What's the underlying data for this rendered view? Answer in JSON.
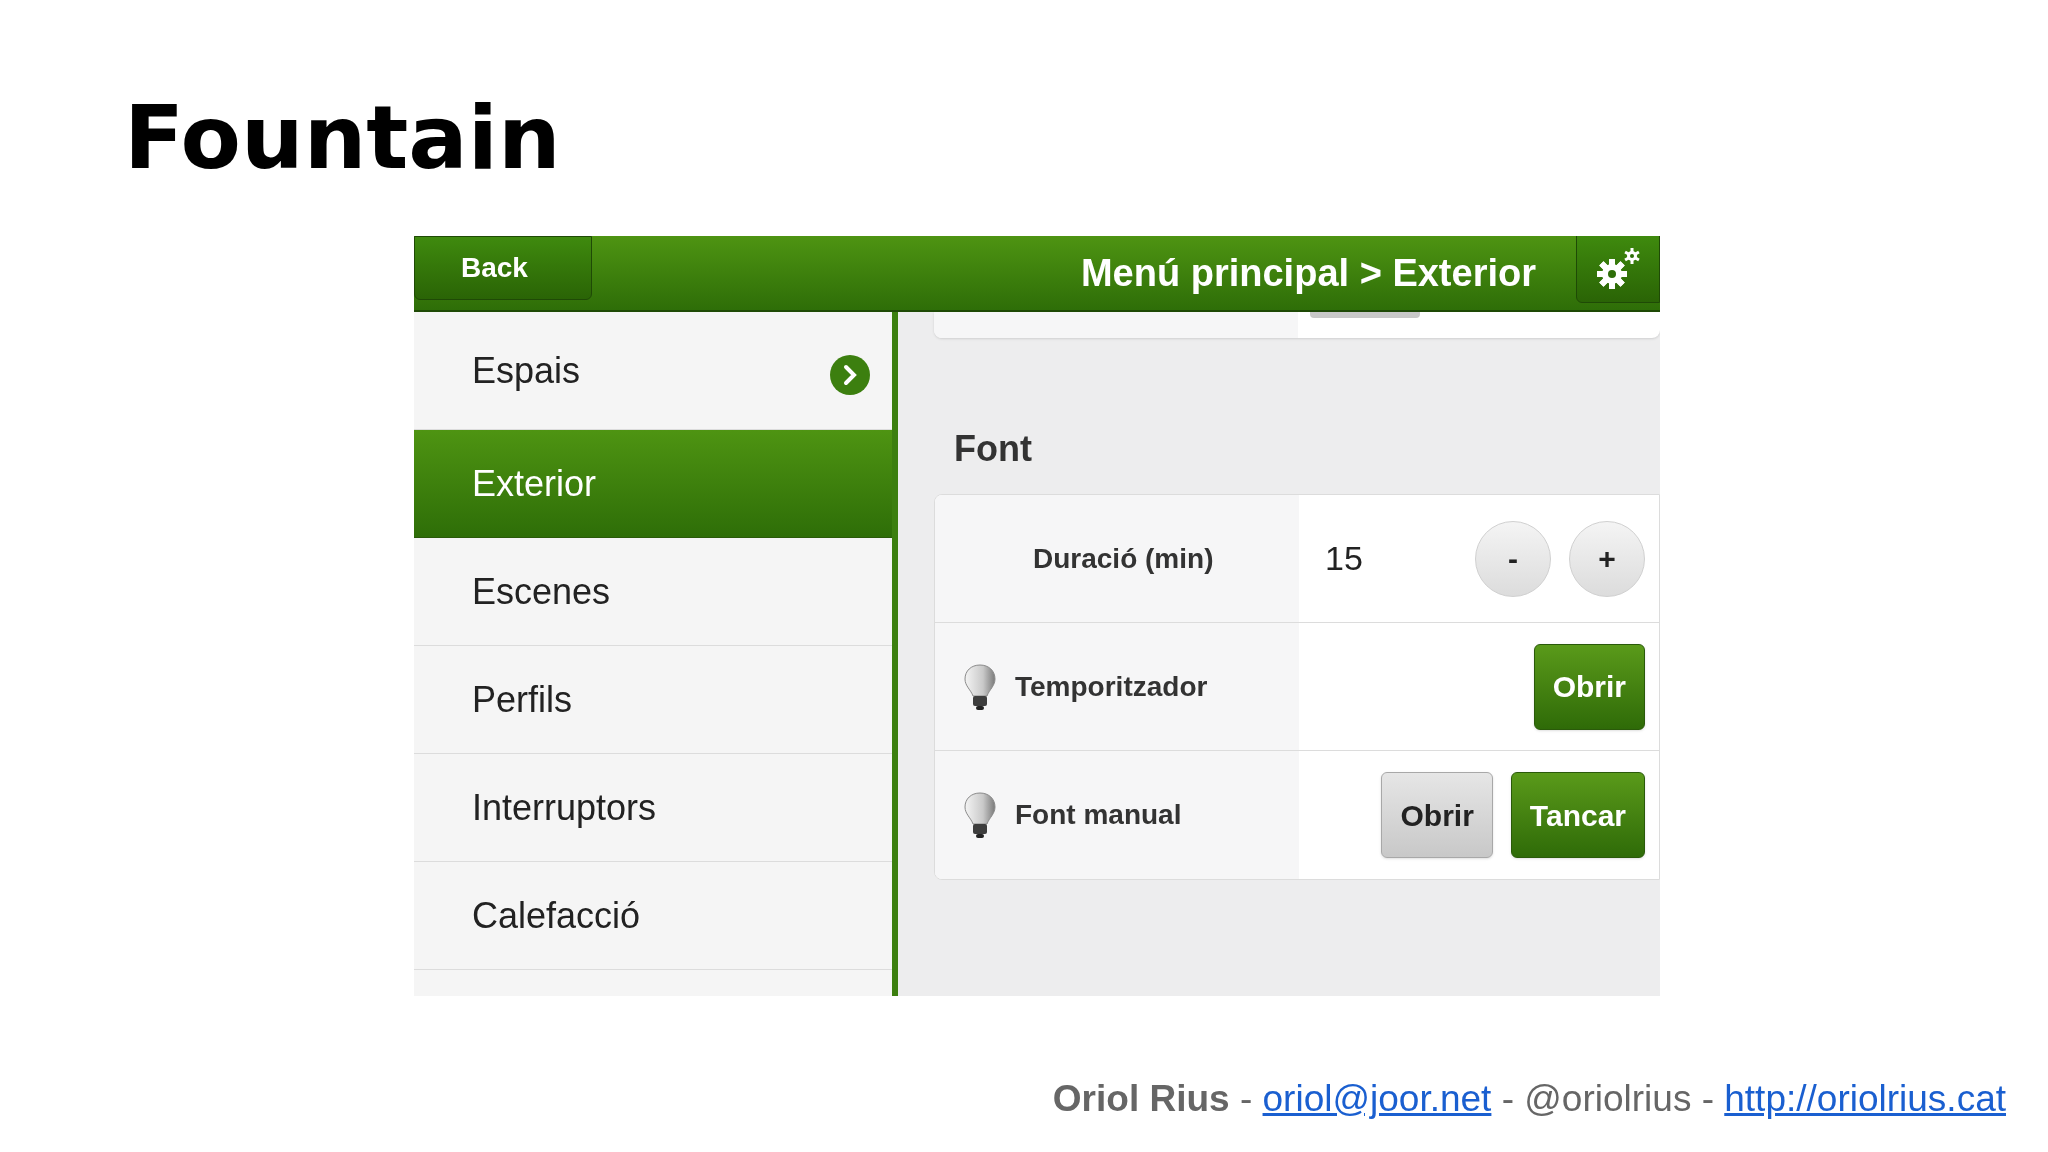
{
  "slide_title": "Fountain",
  "app": {
    "header": {
      "back_button": "Back",
      "breadcrumb": "Menú principal > Exterior"
    },
    "sidebar": {
      "items": [
        {
          "label": "Espais",
          "kind": "submenu",
          "selected": false
        },
        {
          "label": "Exterior",
          "kind": "link",
          "selected": true
        },
        {
          "label": "Escenes",
          "kind": "link",
          "selected": false
        },
        {
          "label": "Perfils",
          "kind": "link",
          "selected": false
        },
        {
          "label": "Interruptors",
          "kind": "link",
          "selected": false
        },
        {
          "label": "Calefacció",
          "kind": "link",
          "selected": false
        }
      ]
    },
    "section": {
      "title": "Font",
      "rows": [
        {
          "kind": "stepper",
          "label": "Duració (min)",
          "value": "15",
          "buttons": [
            "-",
            "+"
          ]
        },
        {
          "kind": "action",
          "label": "Temporitzador",
          "buttons": [
            {
              "label": "Obrir",
              "kind": "primary"
            }
          ]
        },
        {
          "kind": "action",
          "label": "Font manual",
          "buttons": [
            {
              "label": "Obrir",
              "kind": "secondary"
            },
            {
              "label": "Tancar",
              "kind": "primary"
            }
          ]
        }
      ]
    }
  },
  "footer": [
    {
      "kind": "name",
      "text": "Oriol Rius"
    },
    {
      "kind": "text",
      "text": " - "
    },
    {
      "kind": "email",
      "text": "oriol@joor.net"
    },
    {
      "kind": "text",
      "text": " - @oriolrius - "
    },
    {
      "kind": "url",
      "text": "http://oriolrius.cat"
    }
  ]
}
